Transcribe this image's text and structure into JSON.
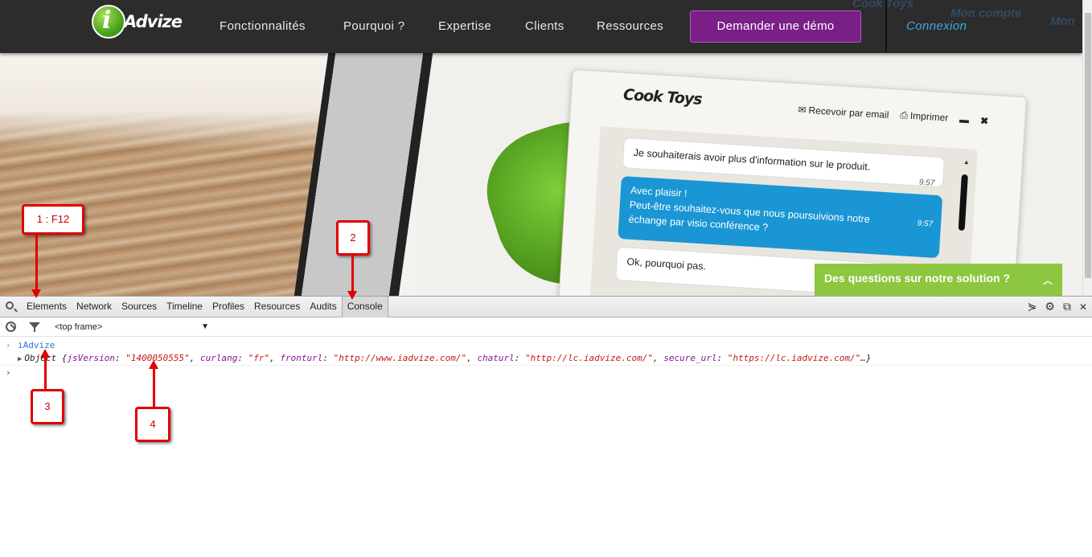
{
  "nav": {
    "logo_text": "Advize",
    "logo_letter": "i",
    "items": [
      "Fonctionnalités",
      "Pourquoi ?",
      "Expertise",
      "Clients",
      "Ressources"
    ],
    "demo_button": "Demander une démo",
    "login": "Connexion",
    "ghost_texts": [
      "Cook Toys",
      "Mon compte",
      "Mon"
    ]
  },
  "hero": {
    "chat_brand": "Cook Toys",
    "email_action": "Recevoir par email",
    "print_action": "Imprimer",
    "messages": [
      {
        "text": "Je souhaiterais avoir plus d'information sur le produit.",
        "time": "9:57"
      },
      {
        "text": "Avec plaisir !\nPeut-être souhaitez-vous que nous poursuivions notre échange par visio conférence ?",
        "time": "9:57"
      },
      {
        "text": "Ok, pourquoi pas."
      }
    ],
    "help_banner": "Des questions sur notre solution ?"
  },
  "devtools": {
    "tabs": [
      "Elements",
      "Network",
      "Sources",
      "Timeline",
      "Profiles",
      "Resources",
      "Audits",
      "Console"
    ],
    "active_tab": "Console",
    "frame_select": "<top frame>",
    "command": "iAdvize",
    "object_prefix": "Object",
    "object_props": [
      {
        "key": "jsVersion",
        "value": "\"1400050555\""
      },
      {
        "key": "curlang",
        "value": "\"fr\""
      },
      {
        "key": "fronturl",
        "value": "\"http://www.iadvize.com/\""
      },
      {
        "key": "chaturl",
        "value": "\"http://lc.iadvize.com/\""
      },
      {
        "key": "secure_url",
        "value": "\"https://lc.iadvize.com/\"…"
      }
    ]
  },
  "annotations": {
    "n1": "1 : F12",
    "n2": "2",
    "n3": "3",
    "n4": "4"
  },
  "colors": {
    "nav_bg": "#2c2c2c",
    "demo_button": "#7a1f86",
    "login_link": "#3fa7e8",
    "chat_blue": "#1a96d4",
    "help_banner": "#8dc63f",
    "annotation_red": "#e00000"
  }
}
